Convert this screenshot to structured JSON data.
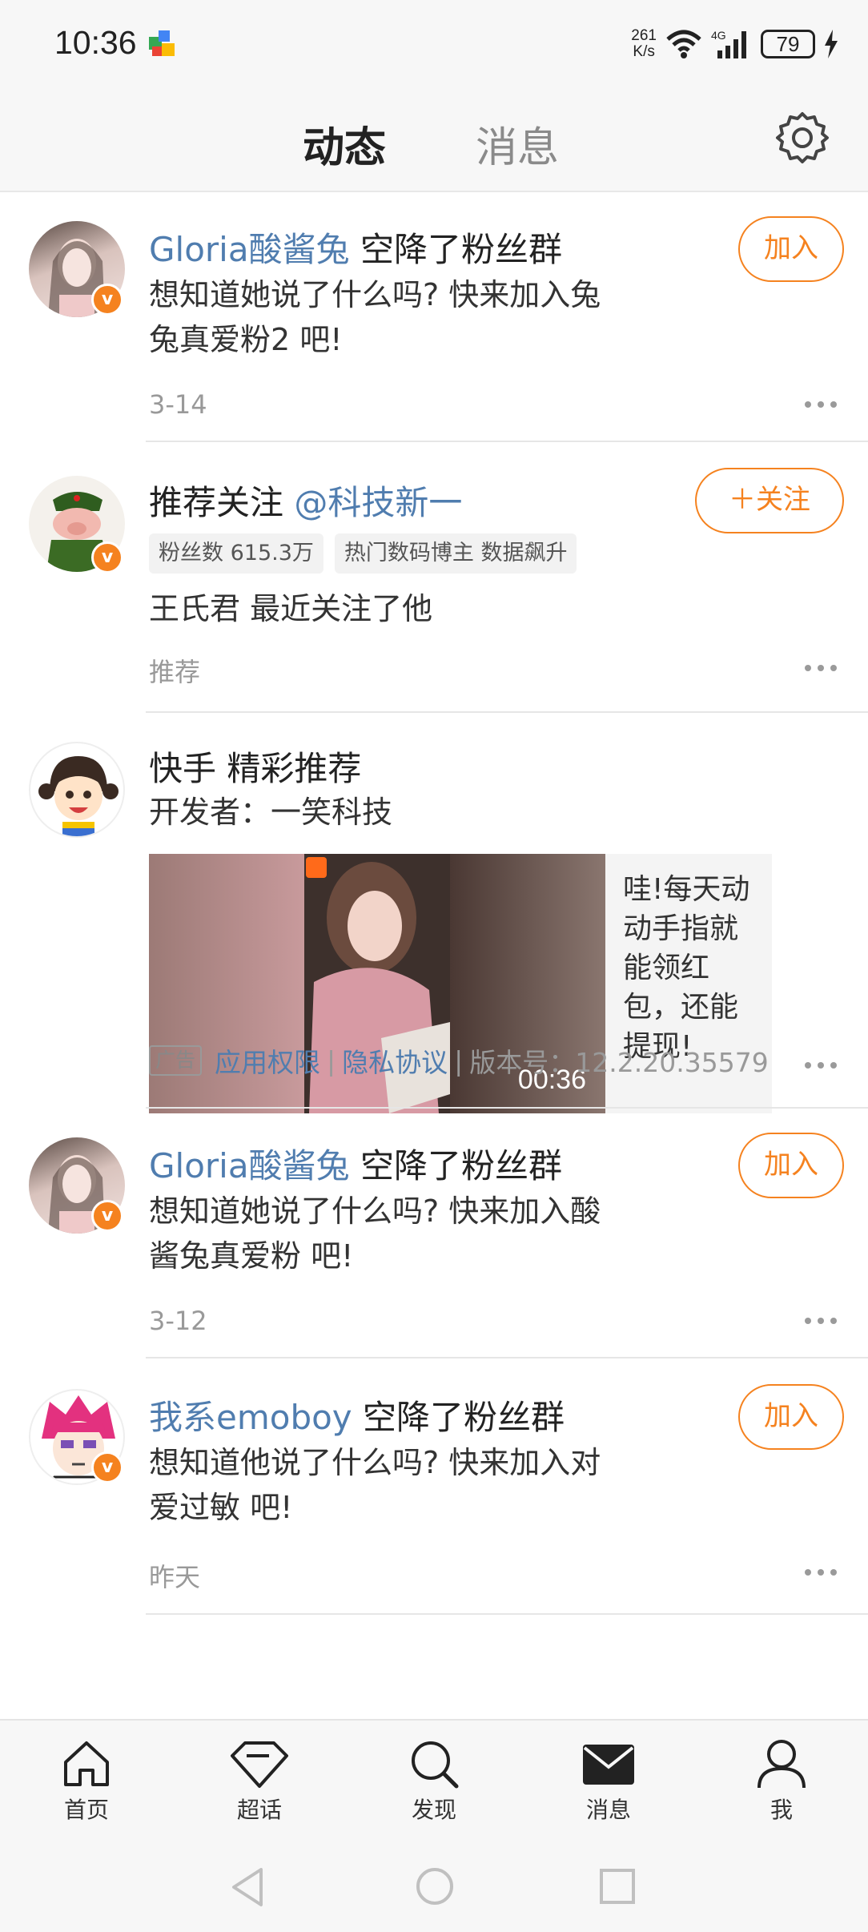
{
  "status_bar": {
    "time": "10:36",
    "net_speed_value": "261",
    "net_speed_unit": "K/s",
    "network": "4G",
    "battery": "79"
  },
  "header": {
    "tabs": [
      {
        "label": "动态",
        "active": true
      },
      {
        "label": "消息",
        "active": false
      }
    ]
  },
  "feed": {
    "items": [
      {
        "user": "Gloria酸酱兔",
        "action": " 空降了粉丝群",
        "text": "想知道她说了什么吗? 快来加入兔兔真爱粉2 吧!",
        "meta": "3-14",
        "button": "加入"
      },
      {
        "prefix": "推荐关注 ",
        "user": "@科技新一",
        "tags": [
          "粉丝数 615.3万",
          "热门数码博主 数据飙升"
        ],
        "text": "王氏君 最近关注了他",
        "meta": "推荐",
        "button": "＋关注"
      },
      {
        "title": "快手 精彩推荐",
        "developer": "开发者：一笑科技",
        "ad_text": "哇!每天动动手指就能领红包，还能提现!",
        "duration": "00:36",
        "ad_label": "广告",
        "link1": "应用权限",
        "link2": "隐私协议",
        "version": "版本号：12.2.20.35579"
      },
      {
        "user": "Gloria酸酱兔",
        "action": " 空降了粉丝群",
        "text": "想知道她说了什么吗? 快来加入酸酱兔真爱粉 吧!",
        "meta": "3-12",
        "button": "加入"
      },
      {
        "user": "我系emoboy",
        "action": " 空降了粉丝群",
        "text": "想知道他说了什么吗? 快来加入对爱过敏 吧!",
        "meta": "昨天",
        "button": "加入"
      }
    ]
  },
  "bottom_nav": {
    "items": [
      {
        "label": "首页",
        "icon": "home-icon"
      },
      {
        "label": "超话",
        "icon": "diamond-icon"
      },
      {
        "label": "发现",
        "icon": "search-icon"
      },
      {
        "label": "消息",
        "icon": "mail-icon",
        "active": true
      },
      {
        "label": "我",
        "icon": "profile-icon"
      }
    ]
  },
  "colors": {
    "accent": "#f5821f",
    "link": "#507daf",
    "tab_underline": "#f6a214"
  }
}
